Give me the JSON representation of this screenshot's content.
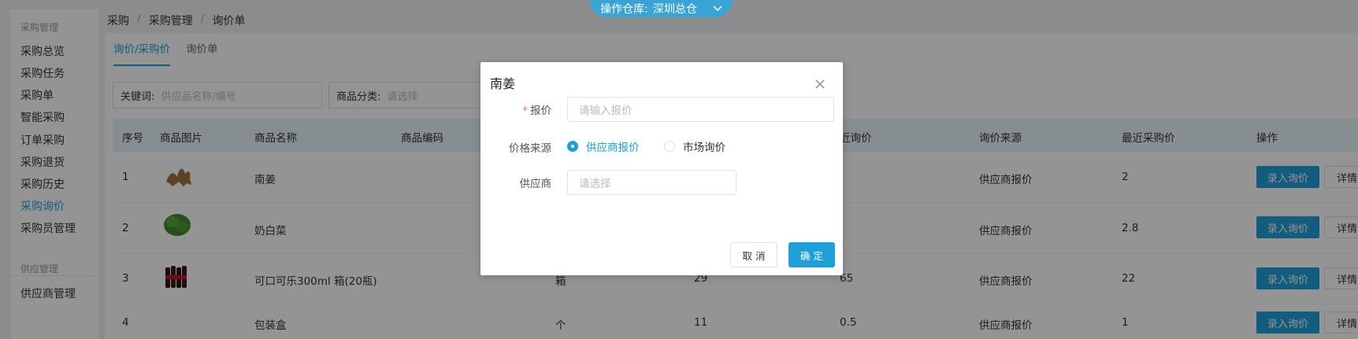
{
  "warehouse": {
    "label": "操作仓库:",
    "value": "深圳总仓"
  },
  "sidebar": {
    "group1": "采购管理",
    "items": [
      "采购总览",
      "采购任务",
      "采购单",
      "智能采购",
      "订单采购",
      "采购退货",
      "采购历史",
      "采购询价",
      "采购员管理"
    ],
    "active_index": 7,
    "group2": "供应管理",
    "items2": [
      "供应商管理"
    ]
  },
  "breadcrumb": [
    "采购",
    "采购管理",
    "询价单"
  ],
  "tabs": [
    "询价/采购价",
    "询价单"
  ],
  "filters": {
    "keyword_label": "关键词:",
    "keyword_placeholder": "供应品名称/编号",
    "category_label": "商品分类:",
    "category_placeholder": "请选择"
  },
  "table": {
    "headers": [
      "序号",
      "商品图片",
      "商品名称",
      "商品编码",
      "近询价",
      "询价来源",
      "最近采购价",
      "操作"
    ],
    "rows": [
      {
        "no": "1",
        "name": "南姜",
        "unit": "",
        "col5": "",
        "col6": "",
        "source": "供应商报价",
        "last_price": "2",
        "image": "ginger-image"
      },
      {
        "no": "2",
        "name": "奶白菜",
        "unit": "",
        "col5": "",
        "col6": "",
        "source": "供应商报价",
        "last_price": "2.8",
        "image": "cabbage-image"
      },
      {
        "no": "3",
        "name": "可口可乐300ml 箱(20瓶)",
        "unit": "箱",
        "col5": "29",
        "col6": "65",
        "source": "供应商报价",
        "last_price": "22",
        "image": "cola-image"
      },
      {
        "no": "4",
        "name": "包装盒",
        "unit": "个",
        "col5": "11",
        "col6": "0.5",
        "source": "供应商报价",
        "last_price": "1",
        "image": ""
      }
    ],
    "entry_label": "录入询价",
    "detail_label": "详情"
  },
  "modal": {
    "title": "南姜",
    "price_label": "报价",
    "price_placeholder": "请输入报价",
    "source_label": "价格来源",
    "source_options": [
      "供应商报价",
      "市场询价"
    ],
    "source_selected": "供应商报价",
    "supplier_label": "供应商",
    "supplier_placeholder": "请选择",
    "cancel_label": "取 消",
    "ok_label": "确 定"
  },
  "colors": {
    "accent": "#1fa0d8",
    "required": "#f56c6c",
    "overlay": "rgba(0,0,0,0.42)"
  }
}
